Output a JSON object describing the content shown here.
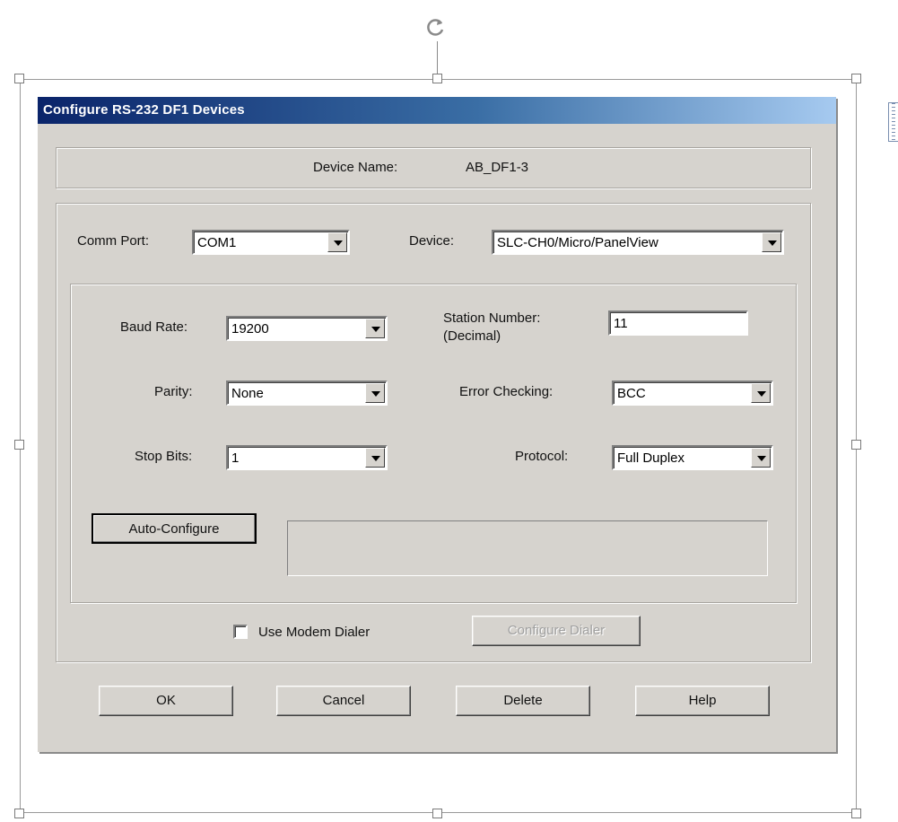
{
  "dialog": {
    "title": "Configure RS-232 DF1 Devices",
    "device_name_label": "Device Name:",
    "device_name_value": "AB_DF1-3"
  },
  "comm_port": {
    "label": "Comm Port:",
    "value": "COM1"
  },
  "device": {
    "label": "Device:",
    "value": "SLC-CH0/Micro/PanelView"
  },
  "baud_rate": {
    "label": "Baud Rate:",
    "value": "19200"
  },
  "parity": {
    "label": "Parity:",
    "value": "None"
  },
  "stop_bits": {
    "label": "Stop Bits:",
    "value": "1"
  },
  "station_number": {
    "label_line1": "Station Number:",
    "label_line2": "(Decimal)",
    "value": "11"
  },
  "error_checking": {
    "label": "Error Checking:",
    "value": "BCC"
  },
  "protocol": {
    "label": "Protocol:",
    "value": "Full Duplex"
  },
  "auto_configure_label": "Auto-Configure",
  "auto_configure_status": "",
  "use_modem_dialer": {
    "label": "Use Modem Dialer",
    "checked": false
  },
  "configure_dialer_label": "Configure Dialer",
  "buttons": {
    "ok": "OK",
    "cancel": "Cancel",
    "delete": "Delete",
    "help": "Help"
  },
  "colors": {
    "titlebar_start": "#0a246a",
    "titlebar_end": "#a6caf0",
    "dialog_face": "#d6d3ce"
  },
  "icons": {
    "rotate": "rotate-icon",
    "dropdown": "chevron-down-icon"
  }
}
